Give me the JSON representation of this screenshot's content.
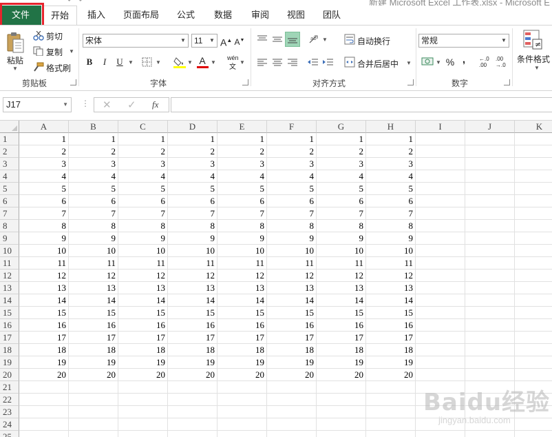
{
  "window": {
    "title": "新建 Microsoft Excel 工作表.xlsx - Microsoft E"
  },
  "tabs": [
    {
      "label": "文件",
      "name": "tab-file"
    },
    {
      "label": "开始",
      "name": "tab-home"
    },
    {
      "label": "插入",
      "name": "tab-insert"
    },
    {
      "label": "页面布局",
      "name": "tab-page-layout"
    },
    {
      "label": "公式",
      "name": "tab-formulas"
    },
    {
      "label": "数据",
      "name": "tab-data"
    },
    {
      "label": "审阅",
      "name": "tab-review"
    },
    {
      "label": "视图",
      "name": "tab-view"
    },
    {
      "label": "团队",
      "name": "tab-team"
    }
  ],
  "ribbon": {
    "clipboard": {
      "label": "剪贴板",
      "paste": "粘贴",
      "cut": "剪切",
      "copy": "复制",
      "format_painter": "格式刷"
    },
    "font": {
      "label": "字体",
      "font_name": "宋体",
      "font_size": "11",
      "bold": "B",
      "italic": "I",
      "underline": "U",
      "phonetic": "wén"
    },
    "alignment": {
      "label": "对齐方式",
      "wrap_text": "自动换行",
      "merge_center": "合并后居中"
    },
    "number": {
      "label": "数字",
      "format": "常规",
      "percent": "%",
      "comma": ",",
      "inc_decimal": ".00",
      "dec_decimal": ".0"
    },
    "styles": {
      "conditional": "条件格式"
    }
  },
  "formula_bar": {
    "name_box": "J17",
    "fx": "fx",
    "value": ""
  },
  "grid": {
    "columns": [
      "A",
      "B",
      "C",
      "D",
      "E",
      "F",
      "G",
      "H",
      "I",
      "J",
      "K"
    ],
    "rows": [
      "1",
      "2",
      "3",
      "4",
      "5",
      "6",
      "7",
      "8",
      "9",
      "10",
      "11",
      "12",
      "13",
      "14",
      "15",
      "16",
      "17",
      "18",
      "19",
      "20",
      "21",
      "22",
      "23",
      "24",
      "25"
    ],
    "filled_columns": 8,
    "filled_rows": 20
  },
  "watermark": {
    "main": "Baidu经验",
    "sub": "jingyan.baidu.com"
  },
  "colors": {
    "file_tab": "#217346",
    "highlight": "#e6242d",
    "accent": "#217346"
  }
}
